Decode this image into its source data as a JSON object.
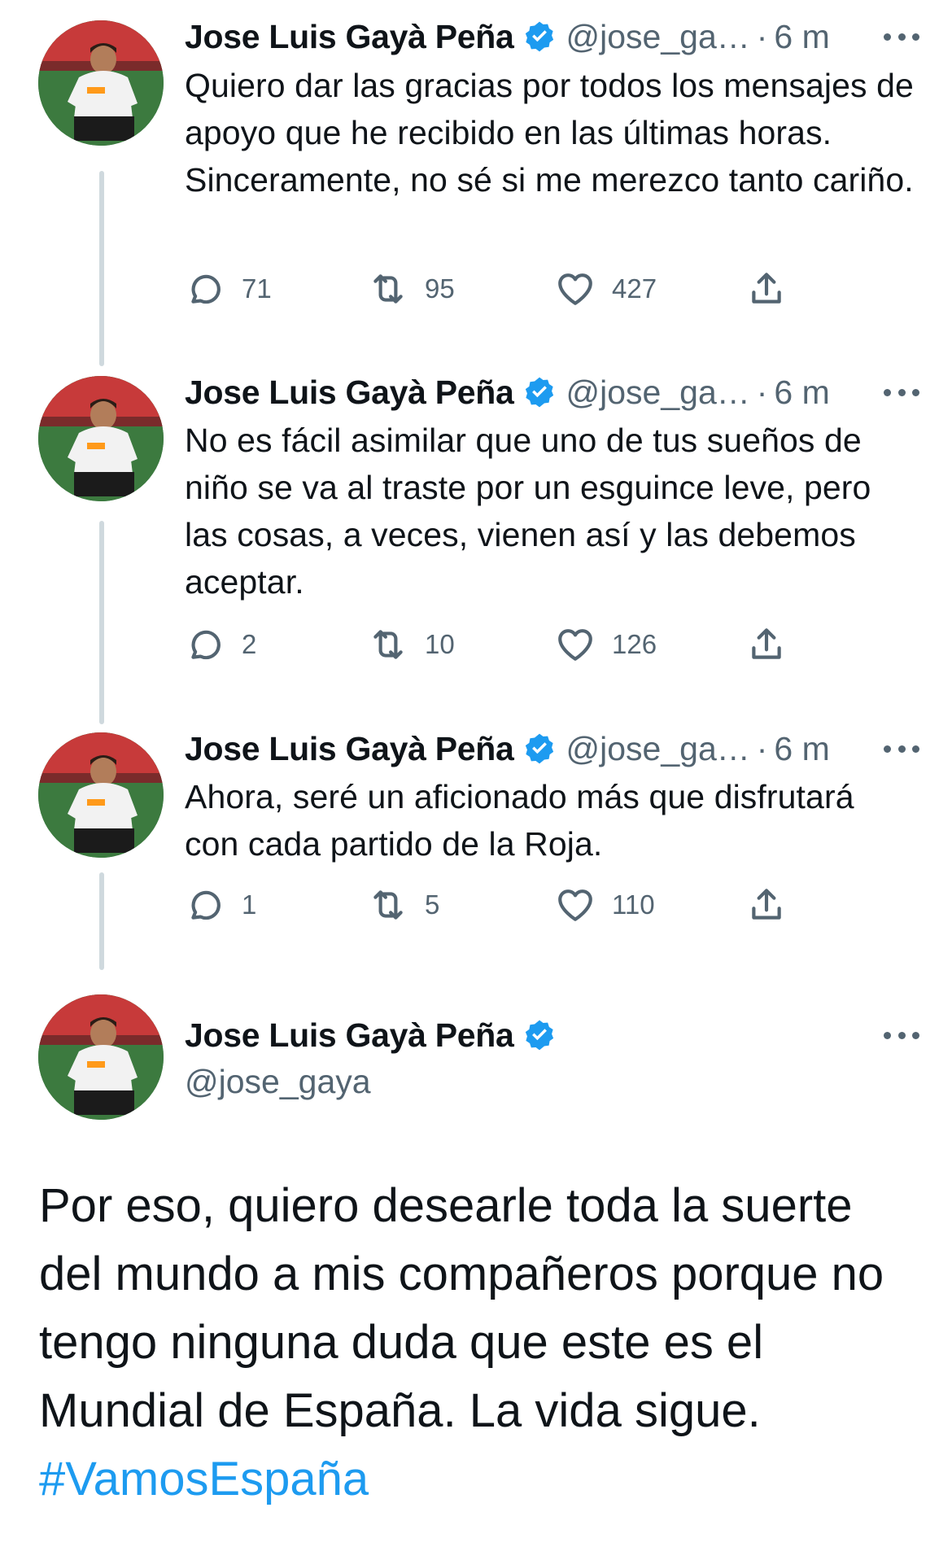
{
  "author": {
    "name": "Jose Luis Gayà Peña",
    "handle_truncated": "@jose_ga…",
    "handle": "@jose_gaya",
    "time": "6 m",
    "separator": "·"
  },
  "colors": {
    "text": "#0f1419",
    "secondary": "#536471",
    "link": "#1d9bf0",
    "verified": "#1d9bf0",
    "thread_line": "#cfd9de"
  },
  "icons": {
    "reply": "comment-bubble-icon",
    "retweet": "retweet-icon",
    "like": "heart-icon",
    "share": "share-upload-icon",
    "verified": "verified-badge-icon",
    "more": "more-dots-icon"
  },
  "tweets": [
    {
      "text": "Quiero dar las gracias por todos los mensajes de apoyo que he recibido en las últimas horas. Sinceramente, no sé si me merezco tanto cariño.",
      "replies": "71",
      "retweets": "95",
      "likes": "427"
    },
    {
      "text": "No es fácil asimilar que uno de tus sueños de niño se va al traste por un esguince leve, pero las cosas, a veces, vienen así y las debemos aceptar.",
      "replies": "2",
      "retweets": "10",
      "likes": "126"
    },
    {
      "text": "Ahora, seré un aficionado más que disfrutará con cada partido de la Roja.",
      "replies": "1",
      "retweets": "5",
      "likes": "110"
    }
  ],
  "main_tweet": {
    "text": "Por eso, quiero desearle toda la suerte del mundo a mis compañeros porque no tengo ninguna duda  que este es el Mundial de España. La vida sigue. ",
    "hashtag": "#VamosEspaña"
  }
}
